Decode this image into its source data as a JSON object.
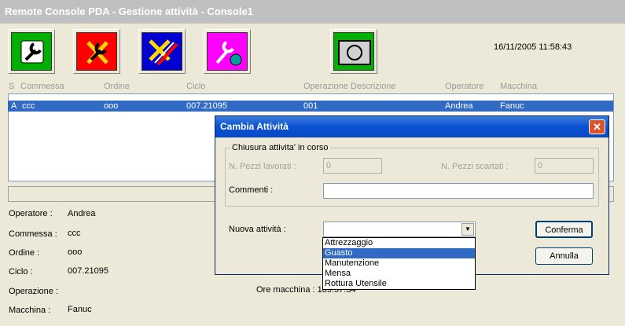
{
  "window": {
    "title": "Remote Console PDA - Gestione attività - Console1"
  },
  "toolbar": {
    "datetime": "16/11/2005 11:58:43",
    "buttons": [
      {
        "icon": "wrench-icon",
        "color": "#00a000"
      },
      {
        "icon": "wrench-cross-icon",
        "color": "#ff0000"
      },
      {
        "icon": "tools-cross-icon",
        "color": "#0000c0"
      },
      {
        "icon": "wrench-gear-icon",
        "color": "#ff00ff"
      },
      {
        "icon": "camera-icon",
        "color": "#00a000"
      }
    ]
  },
  "table": {
    "headers": [
      "S",
      "Commessa",
      "Ordine",
      "Ciclo",
      "Operazione",
      "Descrizione",
      "Operatore",
      "Macchina"
    ],
    "rows": [
      {
        "s": "A",
        "commessa": "ccc",
        "ordine": "ooo",
        "ciclo": "007.21095",
        "operazione": "001",
        "descrizione": "",
        "operatore": "Andrea",
        "macchina": "Fanuc"
      }
    ]
  },
  "details": {
    "operatore_label": "Operatore :",
    "operatore": "Andrea",
    "commessa_label": "Commessa :",
    "commessa": "ccc",
    "ordine_label": "Ordine :",
    "ordine": "ooo",
    "ciclo_label": "Ciclo :",
    "ciclo": "007.21095",
    "operazione_label": "Operazione :",
    "macchina_label": "Macchina :",
    "macchina": "Fanuc",
    "ore_macchina_label": "Ore macchina : 189:57:34"
  },
  "dialog": {
    "title": "Cambia Attività",
    "close": "✕",
    "group_title": "Chiusura attivita' in corso",
    "pezzi_lavorati_label": "N. Pezzi lavorati :",
    "pezzi_lavorati": "0",
    "pezzi_scartati_label": "N. Pezzi scartati :",
    "pezzi_scartati": "0",
    "commenti_label": "Commenti :",
    "commenti": "",
    "nuova_attivita_label": "Nuova attività :",
    "nuova_attivita": "",
    "conferma": "Conferma",
    "annulla": "Annulla",
    "options": [
      "Attrezzaggio",
      "Guasto",
      "Manutenzione",
      "Mensa",
      "Rottura Utensile"
    ],
    "selected_option": "Guasto"
  }
}
